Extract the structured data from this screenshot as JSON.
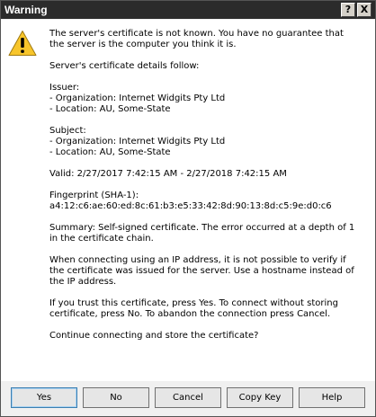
{
  "window": {
    "title": "Warning",
    "help_glyph": "?",
    "close_glyph": "X"
  },
  "icon": "warning-triangle-icon",
  "message": {
    "paragraphs": [
      "The server's certificate is not known. You have no guarantee that the server is the computer you think it is.",
      "Server's certificate details follow:",
      "Issuer:\n- Organization: Internet Widgits Pty Ltd\n- Location: AU, Some-State",
      "Subject:\n- Organization: Internet Widgits Pty Ltd\n- Location: AU, Some-State",
      "Valid: 2/27/2017 7:42:15 AM - 2/27/2018 7:42:15 AM",
      "Fingerprint (SHA-1):\na4:12:c6:ae:60:ed:8c:61:b3:e5:33:42:8d:90:13:8d:c5:9e:d0:c6",
      "Summary: Self-signed certificate. The error occurred at a depth of 1 in the certificate chain.",
      "When connecting using an IP address, it is not possible to verify if the certificate was issued for the server. Use a hostname instead of the IP address.",
      "If you trust this certificate, press Yes. To connect without storing certificate, press No. To abandon the connection press Cancel.",
      "Continue connecting and store the certificate?"
    ]
  },
  "buttons": {
    "yes": "Yes",
    "no": "No",
    "cancel": "Cancel",
    "copy_key": "Copy Key",
    "help": "Help"
  },
  "colors": {
    "titlebar": "#2b2b2b",
    "warning_yellow": "#f7c52b",
    "default_button_border": "#3c7fb1"
  }
}
